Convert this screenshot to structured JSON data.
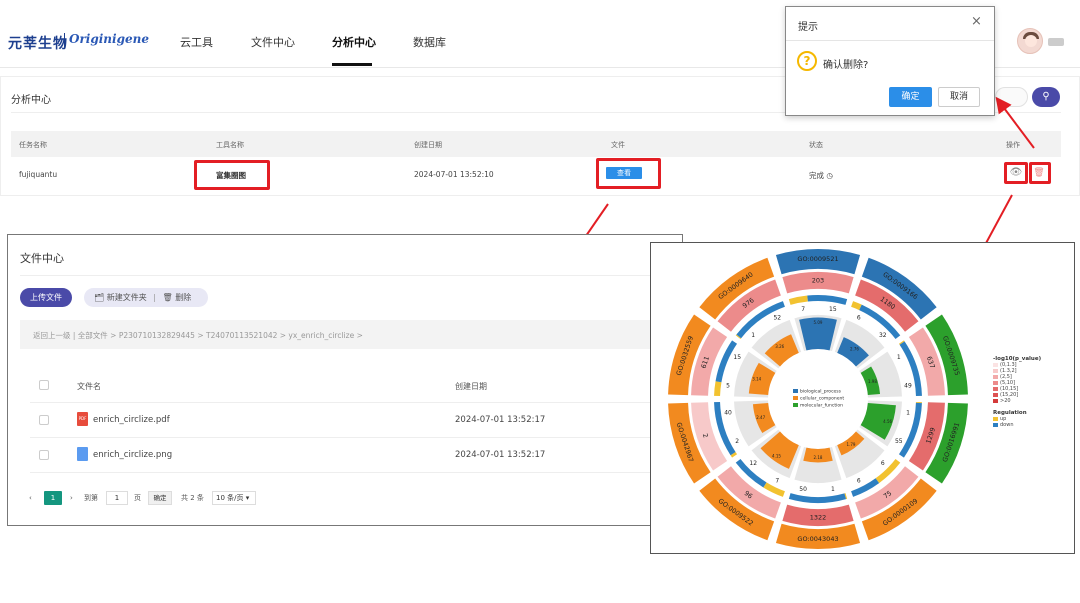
{
  "header": {
    "logo_cn": "元莘生物",
    "logo_en": "Originigene",
    "nav": [
      "云工具",
      "文件中心",
      "分析中心",
      "数据库"
    ],
    "active_nav": "分析中心"
  },
  "analysis": {
    "title": "分析中心",
    "columns": [
      "任务名称",
      "工具名称",
      "创建日期",
      "文件",
      "状态",
      "操作"
    ],
    "row": {
      "task": "fujiquantu",
      "tool": "富集圈图",
      "date": "2024-07-01 13:52:10",
      "file_button": "查看",
      "status": "完成",
      "status_icon": "clock-icon"
    },
    "search_icon": "search-icon"
  },
  "dialog": {
    "title": "提示",
    "close": "×",
    "message": "确认删除?",
    "ok": "确定",
    "cancel": "取消"
  },
  "file_center": {
    "title": "文件中心",
    "upload": "上传文件",
    "new_folder": "新建文件夹",
    "delete": "删除",
    "path": "返回上一级 | 全部文件 > P230710132829445 > T240701135210​42 > yx_enrich_circlize >",
    "columns": [
      "文件名",
      "创建日期"
    ],
    "files": [
      {
        "name": "enrich_circlize.pdf",
        "date": "2024-07-01 13:52:17",
        "icon": "pdf-icon"
      },
      {
        "name": "enrich_circlize.png",
        "date": "2024-07-01 13:52:17",
        "icon": "image-icon"
      }
    ],
    "pagination": {
      "page": "1",
      "goto_label": "到第",
      "goto_value": "1",
      "page_unit": "页",
      "confirm": "确定",
      "total": "共 2 条",
      "page_size": "10 条/页"
    }
  },
  "chart_data": {
    "type": "circos",
    "categories": [
      {
        "id": "GO:0009521",
        "total": 203,
        "up": 7,
        "down": 15,
        "rich": "5.09",
        "cls": "biological_process"
      },
      {
        "id": "GO:0009166",
        "total": 1180,
        "up": 6,
        "down": 32,
        "rich": "2.76",
        "cls": "biological_process"
      },
      {
        "id": "GO:0009735",
        "total": 637,
        "up": 1,
        "down": 49,
        "rich": "1.98",
        "cls": "molecular_function"
      },
      {
        "id": "GO:0016991",
        "total": 1299,
        "up": 1,
        "down": 55,
        "rich": "4.56",
        "cls": "molecular_function"
      },
      {
        "id": "GO:0000109",
        "total": 75,
        "up": 6,
        "down": 6,
        "rich": "1.79",
        "cls": "cellular_component"
      },
      {
        "id": "GO:0043043",
        "total": 1322,
        "up": 1,
        "down": 50,
        "rich": "2.18",
        "cls": "cellular_component"
      },
      {
        "id": "GO:0009522",
        "total": 96,
        "up": 7,
        "down": 12,
        "rich": "4.15",
        "cls": "cellular_component"
      },
      {
        "id": "GO:0042967",
        "total": 2,
        "up": 2,
        "down": 40,
        "rich": "2.47",
        "cls": "cellular_component"
      },
      {
        "id": "GO:0032559",
        "total": 611,
        "up": 5,
        "down": 15,
        "rich": "3.14",
        "cls": "cellular_component"
      },
      {
        "id": "GO:0009640",
        "total": 976,
        "up": 1,
        "down": 52,
        "rich": "3.26",
        "cls": "cellular_component"
      }
    ],
    "legend_classes": [
      "biological_process",
      "cellular_component",
      "molecular_function"
    ],
    "class_colors": {
      "biological_process": "#2c74b3",
      "cellular_component": "#f28a1f",
      "molecular_function": "#2ca02c"
    },
    "pvalue_legend_title": "-log10(p_value)",
    "pvalue_bins": [
      "(0,1.3]",
      "(1.3,2]",
      "(2,5]",
      "(5,10]",
      "(10,15]",
      "(15,20]",
      ">20"
    ],
    "pvalue_colors": [
      "#fbe3e3",
      "#f7c9c9",
      "#f2a9a9",
      "#ec8b8b",
      "#e46c6c",
      "#dd5252",
      "#d43a3a"
    ],
    "regulation_legend_title": "Regulation",
    "regulation": [
      "up",
      "down"
    ],
    "regulation_colors": {
      "up": "#f2c230",
      "down": "#2d7fc1"
    }
  },
  "colors": {
    "primary": "#4a4aa8",
    "link_blue": "#2b8ee8",
    "highlight": "#e31e24",
    "page_active": "#14967f"
  }
}
